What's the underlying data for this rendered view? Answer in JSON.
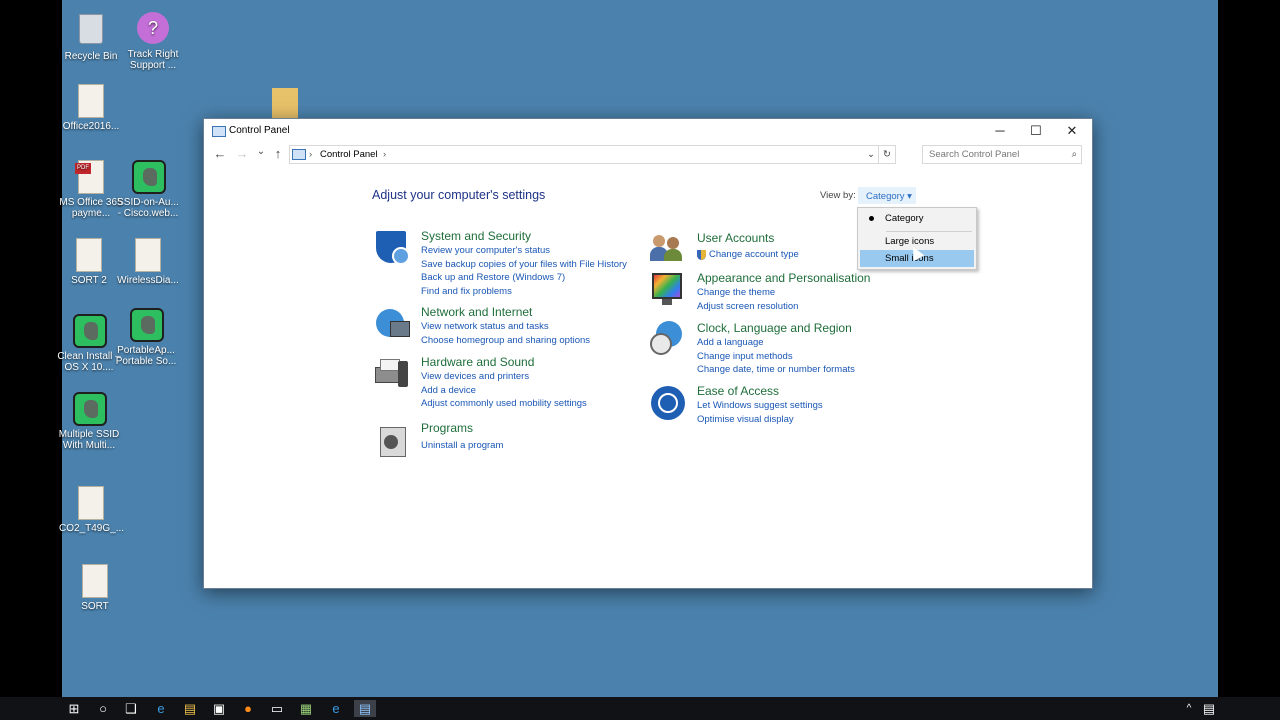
{
  "desktop": {
    "icons": [
      {
        "label": "Recycle Bin"
      },
      {
        "label": "Track Right Support ..."
      },
      {
        "label": "Office2016..."
      },
      {
        "label": "MS Office 365 payme..."
      },
      {
        "label": "SSID-on-Au... - Cisco.web..."
      },
      {
        "label": "SORT 2"
      },
      {
        "label": "WirelessDia..."
      },
      {
        "label": "Clean Install – OS X 10...."
      },
      {
        "label": "PortableAp... Portable So..."
      },
      {
        "label": "Multiple SSID With Multi..."
      },
      {
        "label": "CO2_T49G_..."
      },
      {
        "label": "SORT"
      }
    ]
  },
  "window": {
    "title": "Control Panel",
    "buttons": {
      "minimize": "─",
      "maximize": "☐",
      "close": "✕"
    },
    "nav": {
      "back": "←",
      "forward": "→",
      "recent": "⌄",
      "up": "↑"
    },
    "address": {
      "crumb": "Control Panel",
      "sep": "›",
      "dropdown": "⌄",
      "refresh": "↻"
    },
    "search": {
      "placeholder": "Search Control Panel",
      "icon": "search-icon"
    }
  },
  "main": {
    "heading": "Adjust your computer's settings",
    "view_by_label": "View by:",
    "view_by_value": "Category ▾",
    "menu": {
      "items": [
        {
          "label": "Category",
          "checked": true
        },
        {
          "label": "Large icons"
        },
        {
          "label": "Small icons",
          "highlighted": true
        }
      ]
    },
    "left_categories": [
      {
        "title": "System and Security",
        "icon": "shield-icon",
        "links": [
          "Review your computer's status",
          "Save backup copies of your files with File History",
          "Back up and Restore (Windows 7)",
          "Find and fix problems"
        ]
      },
      {
        "title": "Network and Internet",
        "icon": "network-globe-icon",
        "links": [
          "View network status and tasks",
          "Choose homegroup and sharing options"
        ]
      },
      {
        "title": "Hardware and Sound",
        "icon": "printer-speaker-icon",
        "links": [
          "View devices and printers",
          "Add a device",
          "Adjust commonly used mobility settings"
        ]
      },
      {
        "title": "Programs",
        "icon": "programs-icon",
        "links": [
          "Uninstall a program"
        ]
      }
    ],
    "right_categories": [
      {
        "title": "User Accounts",
        "icon": "users-icon",
        "links": [
          "Change account type"
        ]
      },
      {
        "title": "Appearance and Personalisation",
        "icon": "monitor-palette-icon",
        "links": [
          "Change the theme",
          "Adjust screen resolution"
        ]
      },
      {
        "title": "Clock, Language and Region",
        "icon": "clock-globe-icon",
        "links": [
          "Add a language",
          "Change input methods",
          "Change date, time or number formats"
        ]
      },
      {
        "title": "Ease of Access",
        "icon": "ease-of-access-icon",
        "links": [
          "Let Windows suggest settings",
          "Optimise visual display"
        ]
      }
    ]
  },
  "taskbar": {
    "items": [
      "windows-start-icon",
      "cortana-icon",
      "task-view-icon",
      "edge-icon",
      "file-explorer-icon",
      "store-icon",
      "firefox-icon",
      "cmd-icon",
      "app-icon",
      "internet-explorer-icon",
      "control-panel-icon"
    ],
    "tray": {
      "chevron": "^"
    }
  }
}
